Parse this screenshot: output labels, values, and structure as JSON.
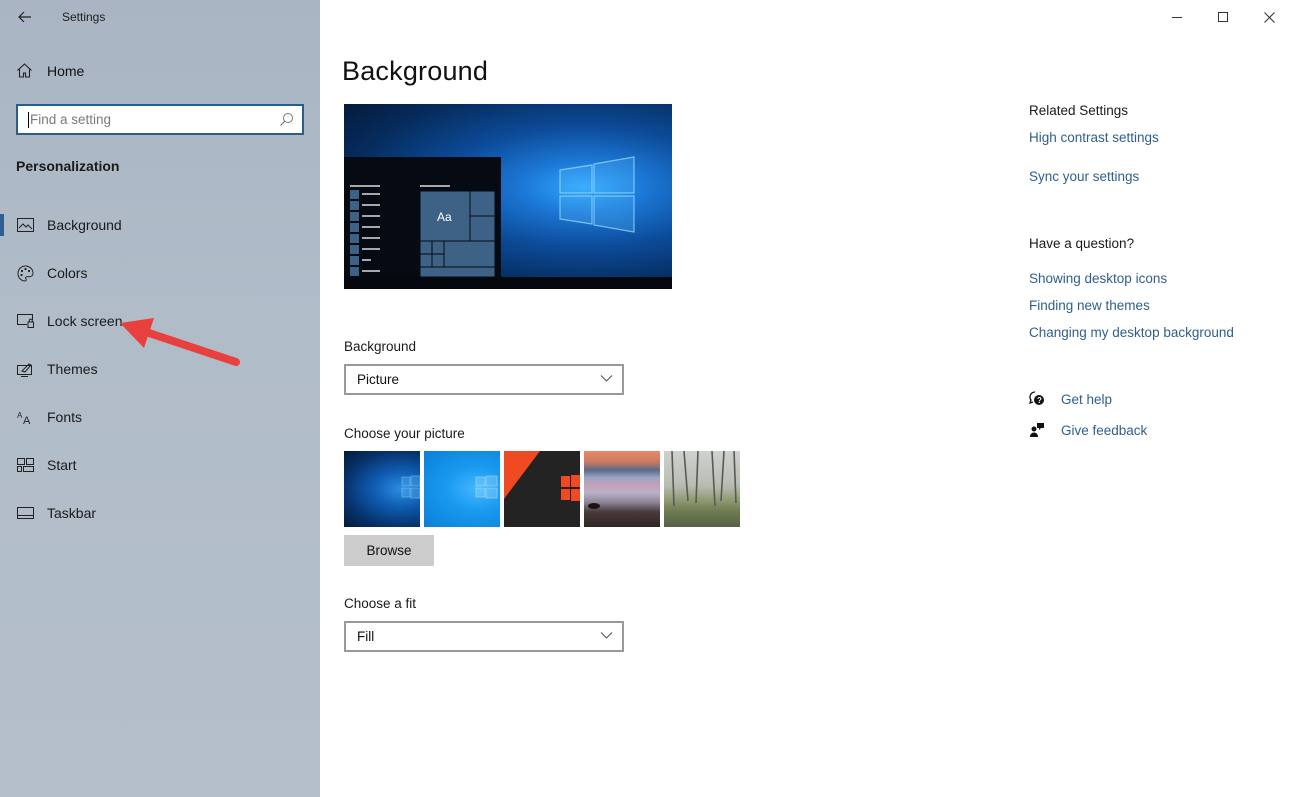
{
  "window": {
    "title": "Settings",
    "controls": {
      "minimize": "minimize-icon",
      "maximize": "maximize-icon",
      "close": "close-icon"
    }
  },
  "sidebar": {
    "home_label": "Home",
    "search_placeholder": "Find a setting",
    "section_title": "Personalization",
    "items": [
      {
        "label": "Background",
        "icon": "picture-icon",
        "active": true
      },
      {
        "label": "Colors",
        "icon": "palette-icon",
        "active": false
      },
      {
        "label": "Lock screen",
        "icon": "lock-screen-icon",
        "active": false
      },
      {
        "label": "Themes",
        "icon": "themes-icon",
        "active": false
      },
      {
        "label": "Fonts",
        "icon": "fonts-icon",
        "active": false
      },
      {
        "label": "Start",
        "icon": "start-icon",
        "active": false
      },
      {
        "label": "Taskbar",
        "icon": "taskbar-icon",
        "active": false
      }
    ],
    "annotation": {
      "type": "red-arrow",
      "points_to": "Lock screen",
      "color": "#e8403c"
    }
  },
  "main": {
    "title": "Background",
    "preview": {
      "tile_label": "Aa"
    },
    "background_label": "Background",
    "background_value": "Picture",
    "choose_picture_label": "Choose your picture",
    "pictures": [
      {
        "name": "windows-dark-blue"
      },
      {
        "name": "windows-light-blue"
      },
      {
        "name": "windows-orange"
      },
      {
        "name": "beach-sunset"
      },
      {
        "name": "forest"
      }
    ],
    "browse_label": "Browse",
    "fit_label": "Choose a fit",
    "fit_value": "Fill"
  },
  "related": {
    "heading": "Related Settings",
    "links": [
      "High contrast settings",
      "Sync your settings"
    ],
    "question_heading": "Have a question?",
    "question_links": [
      "Showing desktop icons",
      "Finding new themes",
      "Changing my desktop background"
    ],
    "get_help": "Get help",
    "give_feedback": "Give feedback"
  },
  "colors": {
    "accent": "#2e5f8f",
    "link": "#2f5f8c",
    "sidebar_bg": "#b0bcc8"
  }
}
